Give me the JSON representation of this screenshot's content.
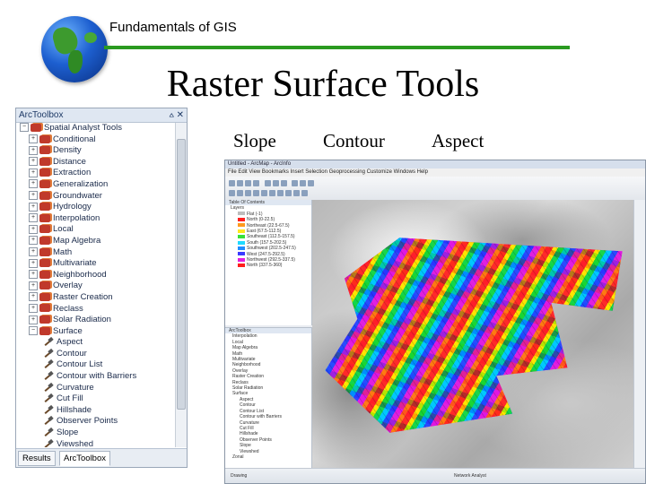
{
  "header": {
    "course": "Fundamentals of GIS",
    "title": "Raster Surface Tools"
  },
  "tabs": [
    "Slope",
    "Contour",
    "Aspect"
  ],
  "toolbox": {
    "title": "ArcToolbox",
    "root": "Spatial Analyst Tools",
    "toolsets": [
      "Conditional",
      "Density",
      "Distance",
      "Extraction",
      "Generalization",
      "Groundwater",
      "Hydrology",
      "Interpolation",
      "Local",
      "Map Algebra",
      "Math",
      "Multivariate",
      "Neighborhood",
      "Overlay",
      "Raster Creation",
      "Reclass",
      "Solar Radiation",
      "Surface"
    ],
    "surface_tools": [
      "Aspect",
      "Contour",
      "Contour List",
      "Contour with Barriers",
      "Curvature",
      "Cut Fill",
      "Hillshade",
      "Observer Points",
      "Slope",
      "Viewshed"
    ],
    "next": "Zonal",
    "bottom_tabs": [
      "Results",
      "ArcToolbox"
    ]
  },
  "arcmap": {
    "window_title": "Untitled - ArcMap - ArcInfo",
    "menu": "File  Edit  View  Bookmarks  Insert  Selection  Geoprocessing  Customize  Windows  Help",
    "toc_title": "Table Of Contents",
    "layers_title": "Layers",
    "legend_items": [
      {
        "label": "Flat (-1)",
        "color": "#bdbdbd"
      },
      {
        "label": "North (0-22.5)",
        "color": "#ff1e1e"
      },
      {
        "label": "Northeast (22.5-67.5)",
        "color": "#ff9a1e"
      },
      {
        "label": "East (67.5-112.5)",
        "color": "#ffe61e"
      },
      {
        "label": "Southeast (112.5-157.5)",
        "color": "#38e038"
      },
      {
        "label": "South (157.5-202.5)",
        "color": "#1ed9ff"
      },
      {
        "label": "Southwest (202.5-247.5)",
        "color": "#1e8cff"
      },
      {
        "label": "West (247.5-292.5)",
        "color": "#3a3aff"
      },
      {
        "label": "Northwest (292.5-337.5)",
        "color": "#e01ee0"
      },
      {
        "label": "North (337.5-360)",
        "color": "#ff1e1e"
      }
    ],
    "toolbox_mini_title": "ArcToolbox",
    "status_left": "Drawing",
    "status_right": "Network Analyst"
  }
}
